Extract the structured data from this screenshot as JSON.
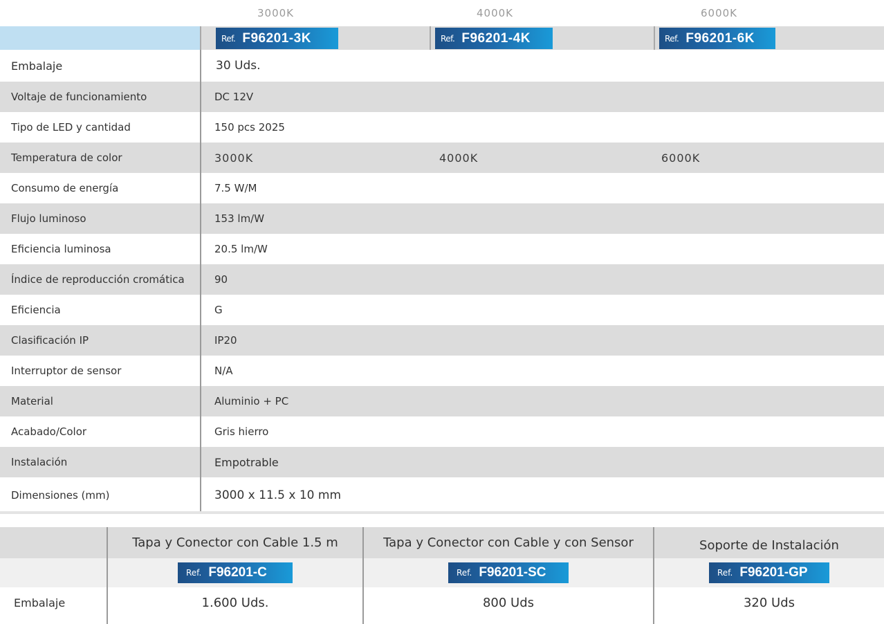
{
  "header": {
    "temperatures": [
      "3000K",
      "4000K",
      "6000K"
    ],
    "ref_label": "Ref.",
    "refs": [
      "F96201-3K",
      "F96201-4K",
      "F96201-6K"
    ]
  },
  "specs": [
    {
      "label": "Embalaje",
      "value": "30 Uds."
    },
    {
      "label": "Voltaje de funcionamiento",
      "value": "DC 12V"
    },
    {
      "label": "Tipo de LED y cantidad",
      "value": "150 pcs 2025"
    },
    {
      "label": "Temperatura de color",
      "values": [
        "3000K",
        "4000K",
        "6000K"
      ]
    },
    {
      "label": "Consumo de energía",
      "value": "7.5 W/M"
    },
    {
      "label": "Flujo luminoso",
      "value": "153 lm/W"
    },
    {
      "label": "Eficiencia luminosa",
      "value": "20.5  lm/W"
    },
    {
      "label": "Índice de reproducción cromática",
      "value": "90"
    },
    {
      "label": "Eficiencia",
      "value": "G"
    },
    {
      "label": "Clasificación IP",
      "value": "IP20"
    },
    {
      "label": "Interruptor de sensor",
      "value": "N/A"
    },
    {
      "label": "Material",
      "value": "Aluminio + PC"
    },
    {
      "label": "Acabado/Color",
      "value": "Gris hierro"
    },
    {
      "label": "Instalación",
      "value": "Empotrable"
    },
    {
      "label": "Dimensiones (mm)",
      "value": "3000 x 11.5 x 10 mm"
    }
  ],
  "accessories": {
    "columns": [
      {
        "title": "Tapa y Conector con Cable 1.5 m",
        "ref": "F96201-C",
        "packaging": "1.600 Uds."
      },
      {
        "title": "Tapa y Conector con Cable y con Sensor",
        "ref": "F96201-SC",
        "packaging": "800 Uds"
      },
      {
        "title": "Soporte de Instalación",
        "ref": "F96201-GP",
        "packaging": "320 Uds"
      }
    ],
    "ref_label": "Ref.",
    "packaging_label": "Embalaje"
  }
}
